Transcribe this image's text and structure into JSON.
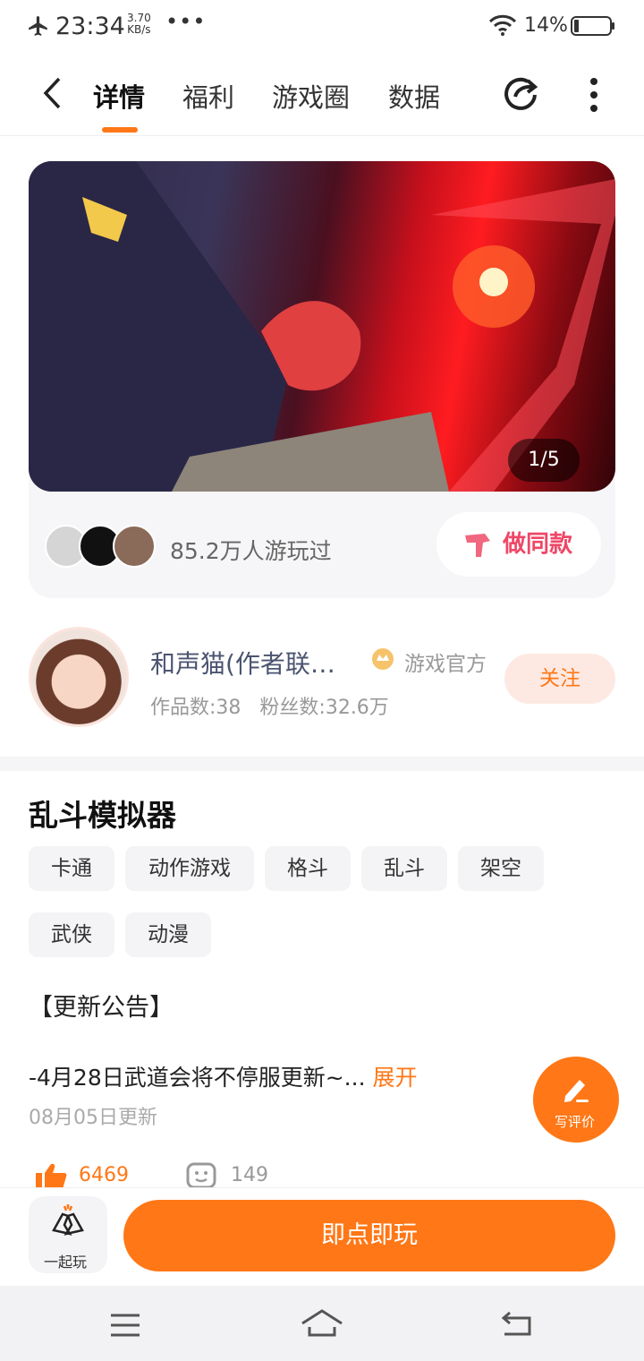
{
  "status": {
    "time": "23:34",
    "speed_value": "3.70",
    "speed_unit": "KB/s",
    "dots": "•••",
    "battery": "14%"
  },
  "tabs": [
    {
      "label": "详情",
      "active": true
    },
    {
      "label": "福利"
    },
    {
      "label": "游戏圈"
    },
    {
      "label": "数据"
    }
  ],
  "banner": {
    "pager": "1/5"
  },
  "plays": {
    "text": "85.2万人游玩过"
  },
  "copy_button": {
    "label": "做同款"
  },
  "author": {
    "name": "和声猫(作者联…",
    "official": "游戏官方",
    "works": "作品数:38",
    "fans": "粉丝数:32.6万",
    "follow": "关注"
  },
  "game": {
    "title": "乱斗模拟器",
    "tags": [
      "卡通",
      "动作游戏",
      "格斗",
      "乱斗",
      "架空",
      "武侠",
      "动漫"
    ],
    "notice_header": "【更新公告】",
    "notice_text": "-4月28日武道会将不停服更新~...",
    "expand": "展开",
    "updated": "08月05日更新"
  },
  "fab": {
    "label": "写评价"
  },
  "stats": {
    "likes": "6469",
    "comments": "149"
  },
  "bottom": {
    "together": "一起玩",
    "play": "即点即玩"
  },
  "colors": {
    "accent": "#ff7716",
    "copy_pink": "#ef4767"
  }
}
